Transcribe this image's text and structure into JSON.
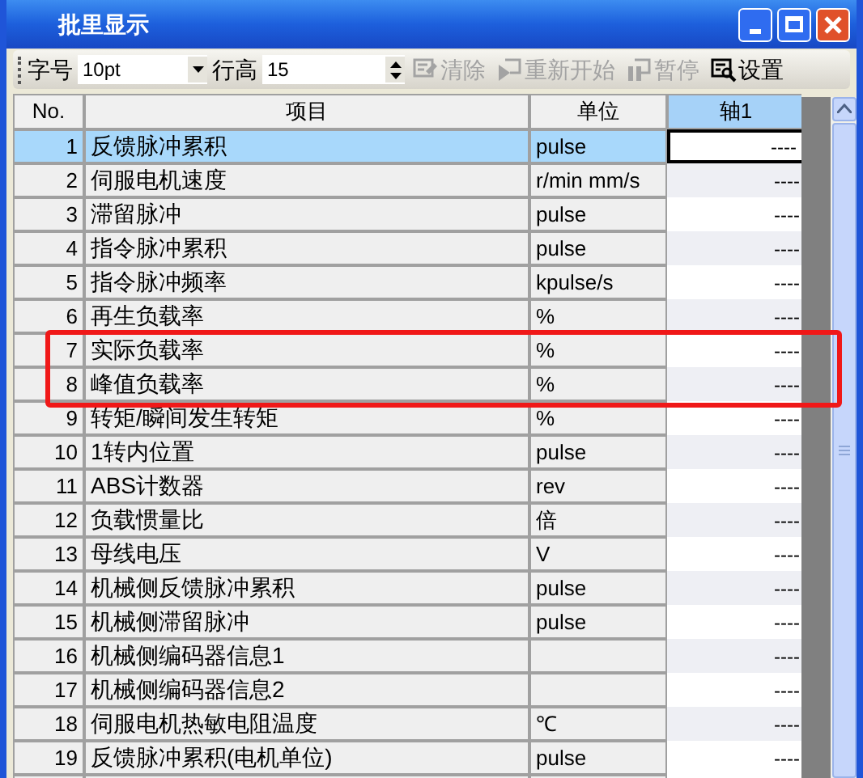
{
  "window": {
    "title": "批里显示"
  },
  "toolbar": {
    "font_size_label": "字号",
    "font_size_value": "10pt",
    "row_height_label": "行高",
    "row_height_value": "15",
    "buttons": [
      {
        "kind": "clear",
        "label": "清除",
        "disabled": true
      },
      {
        "kind": "restart",
        "label": "重新开始",
        "disabled": true
      },
      {
        "kind": "pause",
        "label": "暂停",
        "disabled": true
      },
      {
        "kind": "settings",
        "label": "设置",
        "disabled": false
      }
    ]
  },
  "table": {
    "columns": [
      "No.",
      "项目",
      "单位",
      "轴1"
    ],
    "rows": [
      {
        "no": "1",
        "item": "反馈脉冲累积",
        "unit": "pulse",
        "value": "----",
        "selected": true,
        "marked": false
      },
      {
        "no": "2",
        "item": "伺服电机速度",
        "unit": "r/min mm/s",
        "value": "----",
        "selected": false,
        "marked": false
      },
      {
        "no": "3",
        "item": "滞留脉冲",
        "unit": "pulse",
        "value": "----",
        "selected": false,
        "marked": false
      },
      {
        "no": "4",
        "item": "指令脉冲累积",
        "unit": "pulse",
        "value": "----",
        "selected": false,
        "marked": false
      },
      {
        "no": "5",
        "item": "指令脉冲频率",
        "unit": "kpulse/s",
        "value": "----",
        "selected": false,
        "marked": false
      },
      {
        "no": "6",
        "item": "再生负载率",
        "unit": "%",
        "value": "----",
        "selected": false,
        "marked": false
      },
      {
        "no": "7",
        "item": "实际负载率",
        "unit": "%",
        "value": "----",
        "selected": false,
        "marked": true
      },
      {
        "no": "8",
        "item": "峰值负载率",
        "unit": "%",
        "value": "----",
        "selected": false,
        "marked": true
      },
      {
        "no": "9",
        "item": "转矩/瞬间发生转矩",
        "unit": "%",
        "value": "----",
        "selected": false,
        "marked": false
      },
      {
        "no": "10",
        "item": "1转内位置",
        "unit": "pulse",
        "value": "----",
        "selected": false,
        "marked": false
      },
      {
        "no": "11",
        "item": "ABS计数器",
        "unit": "rev",
        "value": "----",
        "selected": false,
        "marked": false
      },
      {
        "no": "12",
        "item": "负载惯量比",
        "unit": "倍",
        "value": "----",
        "selected": false,
        "marked": false
      },
      {
        "no": "13",
        "item": "母线电压",
        "unit": "V",
        "value": "----",
        "selected": false,
        "marked": false
      },
      {
        "no": "14",
        "item": "机械侧反馈脉冲累积",
        "unit": "pulse",
        "value": "----",
        "selected": false,
        "marked": false
      },
      {
        "no": "15",
        "item": "机械侧滞留脉冲",
        "unit": "pulse",
        "value": "----",
        "selected": false,
        "marked": false
      },
      {
        "no": "16",
        "item": "机械侧编码器信息1",
        "value": "----",
        "selected": false,
        "marked": false
      },
      {
        "no": "17",
        "item": "机械侧编码器信息2",
        "value": "----",
        "selected": false,
        "marked": false
      },
      {
        "no": "18",
        "item": "伺服电机热敏电阻温度",
        "unit": "℃",
        "value": "----",
        "selected": false,
        "marked": false
      },
      {
        "no": "19",
        "item": "反馈脉冲累积(电机单位)",
        "unit": "pulse",
        "value": "----",
        "selected": false,
        "marked": false
      }
    ]
  }
}
